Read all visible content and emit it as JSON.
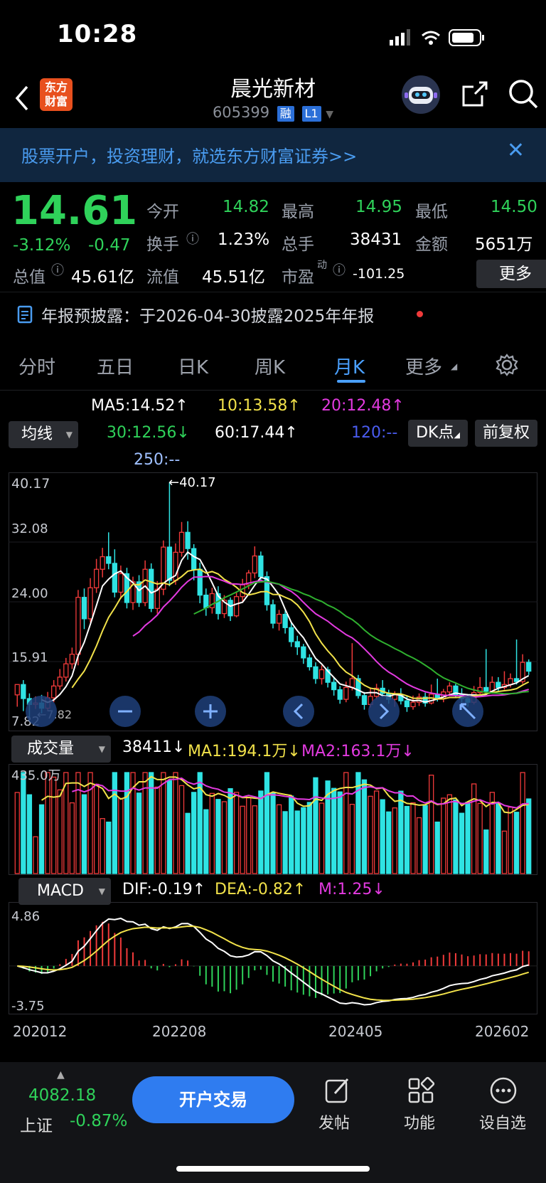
{
  "status": {
    "time": "10:28"
  },
  "header": {
    "title": "晨光新材",
    "code": "605399",
    "tag1": "融",
    "tag2": "L1",
    "logo": "东方\n财富",
    "logo_line1": "东方",
    "logo_line2": "财富"
  },
  "banner": {
    "text": "股票开户，投资理财，就选东方财富证券>>"
  },
  "quote": {
    "price": "14.61",
    "change_pct": "-3.12%",
    "change": "-0.47",
    "open_label": "今开",
    "open": "14.82",
    "high_label": "最高",
    "high": "14.95",
    "low_label": "最低",
    "low": "14.50",
    "turnover_label": "换手",
    "turnover": "1.23%",
    "volume_label": "总手",
    "volume": "38431",
    "amount_label": "金额",
    "amount": "5651万",
    "mcap_label": "总值",
    "mcap": "45.61亿",
    "float_label": "流值",
    "float": "45.51亿",
    "pe_label": "市盈",
    "pe_sup": "动",
    "pe": "-101.25",
    "more": "更多"
  },
  "notice": {
    "text": "年报预披露：于2026-04-30披露2025年年报"
  },
  "tabs": [
    "分时",
    "五日",
    "日K",
    "周K",
    "月K",
    "更多"
  ],
  "ma": {
    "ma5": "MA5:14.52↑",
    "ma10": "10:13.58↑",
    "ma20": "20:12.48↑",
    "ma30": "30:12.56↓",
    "ma60": "60:17.44↑",
    "ma120": "120:--",
    "ma250": "250:--",
    "select": "均线",
    "dk": "DK点",
    "fq": "前复权"
  },
  "kline_axis": {
    "y1": "40.17",
    "y2": "32.08",
    "y3": "24.00",
    "y4": "15.91",
    "y5": "7.82",
    "max_label": "←40.17",
    "min_label": "←7.82"
  },
  "volume": {
    "select": "成交量",
    "v": "38411↓",
    "ma1": "MA1:194.1万↓",
    "ma2": "MA2:163.1万↓",
    "ymax": "435.0万"
  },
  "macd": {
    "select": "MACD",
    "dif": "DIF:-0.19↑",
    "dea": "DEA:-0.82↑",
    "m": "M:1.25↓",
    "ymax": "4.86",
    "ymin": "-3.75"
  },
  "x_axis": [
    "202012",
    "202208",
    "202405",
    "202602"
  ],
  "bottom": {
    "index_value": "4082.18",
    "index_name": "上证",
    "index_chg": "-0.87%",
    "open_btn": "开户交易",
    "post": "发帖",
    "func": "功能",
    "watch": "设自选"
  },
  "colors": {
    "up": "#f03a3a",
    "down": "#2fe3e3",
    "green": "#2fd25a",
    "blue": "#4aa0ff",
    "yellow": "#f2e24a",
    "magenta": "#e33ae0"
  },
  "chart_data": {
    "type": "candlestick",
    "y_range": [
      7.82,
      40.17
    ],
    "candles": [
      [
        11.4,
        12.8,
        12.8,
        9.8
      ],
      [
        12.8,
        10.9,
        13.4,
        9.2
      ],
      [
        10.9,
        10.1,
        11.6,
        8.4
      ],
      [
        10.1,
        10.3,
        11.2,
        9.5
      ],
      [
        10.3,
        9.6,
        11.4,
        8.9
      ],
      [
        9.6,
        11.0,
        11.8,
        9.3
      ],
      [
        11.0,
        12.6,
        13.4,
        10.4
      ],
      [
        12.6,
        13.8,
        14.9,
        12.1
      ],
      [
        13.8,
        15.6,
        16.4,
        13.2
      ],
      [
        15.6,
        16.9,
        17.8,
        14.9
      ],
      [
        16.9,
        24.6,
        25.6,
        15.4
      ],
      [
        24.6,
        21.7,
        25.8,
        20.3
      ],
      [
        21.7,
        25.9,
        27.2,
        21.2
      ],
      [
        25.9,
        28.4,
        29.8,
        25.2
      ],
      [
        28.4,
        30.1,
        31.3,
        27.3
      ],
      [
        30.1,
        29.2,
        33.4,
        28.4
      ],
      [
        29.2,
        25.3,
        31.1,
        24.6
      ],
      [
        25.3,
        27.8,
        28.9,
        24.4
      ],
      [
        27.8,
        23.9,
        28.6,
        23.1
      ],
      [
        23.9,
        26.7,
        27.4,
        22.9
      ],
      [
        26.7,
        23.9,
        27.6,
        23.3
      ],
      [
        23.9,
        28.4,
        29.6,
        23.4
      ],
      [
        28.4,
        23.1,
        29.2,
        22.6
      ],
      [
        23.1,
        25.7,
        26.8,
        22.4
      ],
      [
        25.7,
        31.4,
        32.3,
        24.9
      ],
      [
        31.4,
        26.9,
        40.17,
        26.1
      ],
      [
        26.9,
        30.7,
        31.9,
        26.3
      ],
      [
        30.7,
        33.4,
        34.8,
        30.1
      ],
      [
        33.4,
        31.2,
        34.9,
        29.7
      ],
      [
        31.2,
        28.4,
        31.8,
        26.9
      ],
      [
        28.4,
        24.9,
        29.3,
        23.8
      ],
      [
        24.9,
        23.2,
        25.8,
        22.1
      ],
      [
        23.2,
        25.1,
        25.9,
        22.4
      ],
      [
        25.1,
        22.4,
        26.1,
        21.6
      ],
      [
        22.4,
        24.2,
        24.9,
        21.8
      ],
      [
        24.2,
        22.1,
        24.6,
        21.4
      ],
      [
        22.1,
        24.7,
        25.4,
        21.9
      ],
      [
        24.7,
        26.3,
        27.1,
        24.0
      ],
      [
        26.3,
        27.9,
        28.3,
        25.7
      ],
      [
        27.9,
        30.2,
        31.5,
        27.2
      ],
      [
        30.2,
        27.4,
        30.8,
        26.9
      ],
      [
        27.4,
        23.6,
        28.1,
        22.8
      ],
      [
        23.6,
        21.1,
        24.3,
        20.4
      ],
      [
        21.1,
        22.3,
        22.9,
        20.1
      ],
      [
        22.3,
        20.5,
        22.8,
        19.7
      ],
      [
        20.5,
        18.6,
        21.3,
        17.9
      ],
      [
        18.6,
        17.9,
        19.4,
        16.8
      ],
      [
        17.9,
        16.4,
        18.3,
        15.6
      ],
      [
        16.4,
        15.2,
        16.9,
        14.7
      ],
      [
        15.2,
        13.6,
        15.8,
        12.9
      ],
      [
        13.6,
        14.8,
        15.4,
        12.8
      ],
      [
        14.8,
        13.1,
        15.2,
        12.4
      ],
      [
        13.1,
        12.1,
        13.8,
        11.3
      ],
      [
        12.1,
        10.8,
        12.6,
        10.2
      ],
      [
        10.8,
        12.4,
        13.2,
        10.4
      ],
      [
        12.4,
        13.6,
        18.4,
        12.0
      ],
      [
        13.6,
        11.3,
        14.1,
        10.9
      ],
      [
        11.3,
        10.1,
        11.8,
        9.4
      ],
      [
        10.1,
        11.2,
        12.4,
        9.7
      ],
      [
        11.2,
        12.3,
        12.9,
        10.8
      ],
      [
        12.3,
        11.6,
        13.4,
        11.1
      ],
      [
        11.6,
        10.8,
        12.1,
        10.2
      ],
      [
        10.8,
        11.4,
        11.9,
        9.8
      ],
      [
        11.4,
        10.6,
        12.3,
        10.1
      ],
      [
        10.6,
        9.8,
        11.2,
        9.1
      ],
      [
        9.8,
        10.4,
        11.3,
        9.4
      ],
      [
        10.4,
        11.1,
        11.6,
        9.9
      ],
      [
        11.1,
        10.3,
        11.7,
        9.8
      ],
      [
        10.3,
        11.5,
        12.8,
        10.1
      ],
      [
        11.5,
        10.9,
        13.6,
        10.5
      ],
      [
        10.9,
        11.8,
        12.2,
        10.4
      ],
      [
        11.8,
        12.6,
        13.1,
        11.2
      ],
      [
        12.6,
        11.4,
        12.9,
        11.0
      ],
      [
        11.4,
        10.9,
        12.3,
        10.4
      ],
      [
        10.9,
        10.4,
        11.4,
        9.8
      ],
      [
        10.4,
        11.7,
        12.6,
        10.1
      ],
      [
        11.7,
        12.4,
        13.8,
        11.3
      ],
      [
        12.4,
        11.9,
        17.6,
        11.4
      ],
      [
        11.9,
        13.1,
        13.9,
        11.6
      ],
      [
        13.1,
        12.4,
        13.8,
        11.9
      ],
      [
        12.4,
        12.8,
        14.6,
        12.1
      ],
      [
        12.8,
        13.6,
        14.3,
        12.4
      ],
      [
        13.6,
        13.2,
        18.9,
        12.8
      ],
      [
        13.2,
        15.8,
        16.9,
        12.9
      ],
      [
        15.8,
        14.61,
        16.2,
        14.1
      ]
    ],
    "volume_range": [
      0,
      4350000
    ],
    "macd_range": [
      -3.75,
      4.86
    ]
  }
}
